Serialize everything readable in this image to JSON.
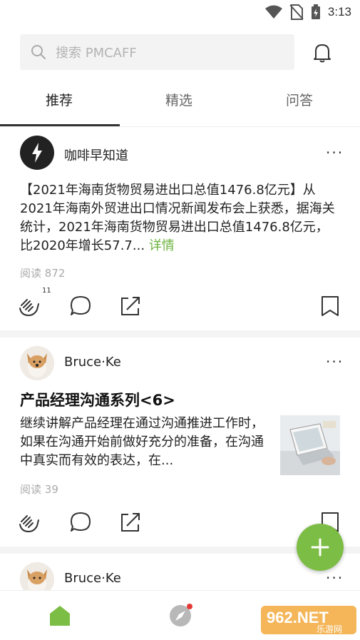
{
  "status_bar": {
    "time": "3:13"
  },
  "search": {
    "placeholder": "搜索 PMCAFF"
  },
  "tabs": [
    {
      "label": "推荐",
      "active": true
    },
    {
      "label": "精选",
      "active": false
    },
    {
      "label": "问答",
      "active": false
    }
  ],
  "feed": [
    {
      "author": "咖啡早知道",
      "text": "【2021年海南货物贸易进出口总值1476.8亿元】从2021年海南外贸进出口情况新闻发布会上获悉，据海关统计，2021年海南货物贸易进出口总值1476.8亿元，比2020年增长57.7...",
      "detail_label": "详情",
      "reads_label": "阅读",
      "reads": "872",
      "clap_count": "11",
      "more": "···"
    },
    {
      "author": "Bruce·Ke",
      "title": "产品经理沟通系列<6>",
      "excerpt": "继续讲解产品经理在通过沟通推进工作时，如果在沟通开始前做好充分的准备，在沟通中真实而有效的表达，在...",
      "reads_label": "阅读",
      "reads": "39",
      "more": "···"
    },
    {
      "author": "Bruce·Ke",
      "more": "···"
    }
  ],
  "colors": {
    "accent": "#7cbd45",
    "link": "#6cb33f",
    "notification_dot": "#e53935"
  },
  "bottom_nav": {
    "items": [
      "home-icon",
      "compass-icon",
      "profile-icon"
    ]
  },
  "watermark": {
    "text": "962.NET",
    "subtext": "乐游网"
  }
}
